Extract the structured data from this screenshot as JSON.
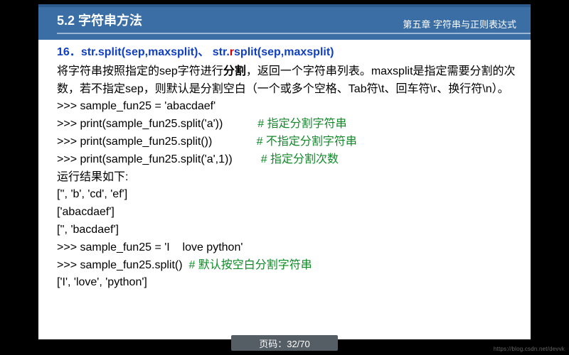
{
  "header": {
    "section": "5.2 字符串方法",
    "chapter": "第五章  字符串与正则表达式"
  },
  "content": {
    "title_num": "16．",
    "title_a": "str.split(sep,maxsplit)、  str.",
    "title_r": "r",
    "title_b": "split(sep,maxsplit)",
    "desc_a": "将字符串按照指定的sep字符进行",
    "desc_bold": "分割",
    "desc_b": "，返回一个字符串列表。maxsplit是指定需要分割的次数，若不指定sep，则默认是分割空白（一个或多个空格、Tab符\\t、回车符\\r、换行符\\n）。",
    "line1": ">>> sample_fun25 = 'abacdaef'",
    "line2_code": ">>> print(sample_fun25.split('a'))",
    "line2_cmt": "# 指定分割字符串",
    "line3_code": ">>> print(sample_fun25.split())",
    "line3_cmt": "# 不指定分割字符串",
    "line4_code": ">>> print(sample_fun25.split('a',1))",
    "line4_cmt": "# 指定分割次数",
    "line5": "运行结果如下:",
    "line6": "['', 'b', 'cd', 'ef']",
    "line7": "['abacdaef']",
    "line8": "['', 'bacdaef']",
    "line9": ">>> sample_fun25 = 'I    love python'",
    "line10_code": ">>> sample_fun25.split()  ",
    "line10_cmt": "# 默认按空白分割字符串",
    "line11": "['I', 'love', 'python']"
  },
  "pager": {
    "label": "页码：32/70"
  },
  "watermark": "https://blog.csdn.net/devvk"
}
